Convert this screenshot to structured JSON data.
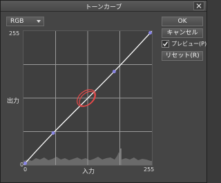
{
  "window": {
    "title": "トーンカーブ",
    "close_icon": "close-icon"
  },
  "channel": {
    "selected": "RGB"
  },
  "graph": {
    "label_max_y": "255",
    "label_min_y": "0",
    "label_min_x": "0",
    "label_max_x": "255",
    "y_label": "出力",
    "x_label": "入力"
  },
  "buttons": {
    "ok": "OK",
    "cancel": "キャンセル",
    "reset": "リセット(R)"
  },
  "preview": {
    "label": "プレビュー(P)",
    "checked": true
  },
  "curve": {
    "points": [
      [
        0,
        0
      ],
      [
        59,
        61
      ],
      [
        180,
        178
      ],
      [
        255,
        255
      ]
    ],
    "annotation_color": "#e84a4a",
    "line_color": "#ffffff",
    "point_color": "#8a86e6"
  }
}
